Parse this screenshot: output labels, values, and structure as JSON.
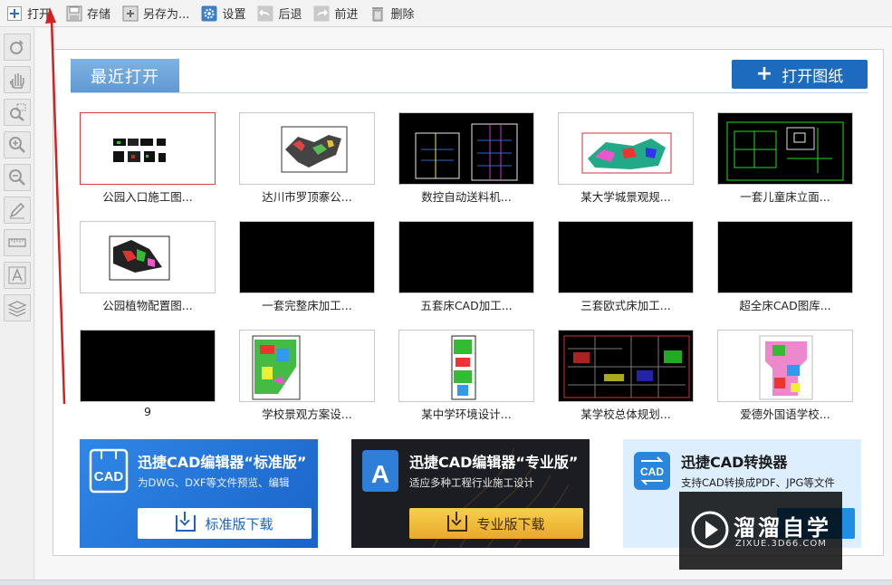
{
  "toolbar": {
    "open": "打开",
    "save": "存储",
    "save_as": "另存为...",
    "settings": "设置",
    "back": "后退",
    "forward": "前进",
    "delete": "删除"
  },
  "left_tools": [
    "rotate-icon",
    "pan-hand-icon",
    "zoom-window-icon",
    "zoom-in-icon",
    "zoom-out-icon",
    "pencil-icon",
    "ruler-icon",
    "text-icon",
    "layers-icon"
  ],
  "recent": {
    "tab_label": "最近打开",
    "open_drawing": "打开图纸"
  },
  "files": [
    {
      "name": "公园入口施工图...",
      "preview": "dark-boxes",
      "selected": true
    },
    {
      "name": "达川市罗顶寨公...",
      "preview": "map-color"
    },
    {
      "name": "数控自动送料机...",
      "preview": "machine"
    },
    {
      "name": "某大学城景观规...",
      "preview": "campus"
    },
    {
      "name": "一套儿童床立面...",
      "preview": "green-frame"
    },
    {
      "name": "公园植物配置图...",
      "preview": "park-plant"
    },
    {
      "name": "一套完整床加工...",
      "preview": "black"
    },
    {
      "name": "五套床CAD加工...",
      "preview": "black"
    },
    {
      "name": "三套欧式床加工...",
      "preview": "black"
    },
    {
      "name": "超全床CAD图库...",
      "preview": "black"
    },
    {
      "name": "9",
      "preview": "black"
    },
    {
      "name": "学校景观方案设...",
      "preview": "school-plan"
    },
    {
      "name": "某中学环境设计...",
      "preview": "narrow-plan"
    },
    {
      "name": "某学校总体规划...",
      "preview": "dark-plan"
    },
    {
      "name": "爱德外国语学校...",
      "preview": "pink-plan"
    }
  ],
  "banners": [
    {
      "title": "迅捷CAD编辑器“标准版”",
      "subtitle": "为DWG、DXF等文件预览、编辑",
      "button": "标准版下载",
      "logo": "CAD"
    },
    {
      "title": "迅捷CAD编辑器“专业版”",
      "subtitle": "适应多种工程行业施工设计",
      "button": "专业版下载",
      "logo": "A"
    },
    {
      "title": "迅捷CAD转换器",
      "subtitle": "支持CAD转换成PDF、JPG等文件",
      "button": "",
      "logo": "CAD"
    }
  ],
  "watermark": {
    "title": "溜溜自学",
    "url": "ZIXUE.3D66.COM"
  },
  "colors": {
    "accent": "#1c6bbf",
    "tab": "#6fa6db",
    "annotation_arrow": "#d42020"
  }
}
